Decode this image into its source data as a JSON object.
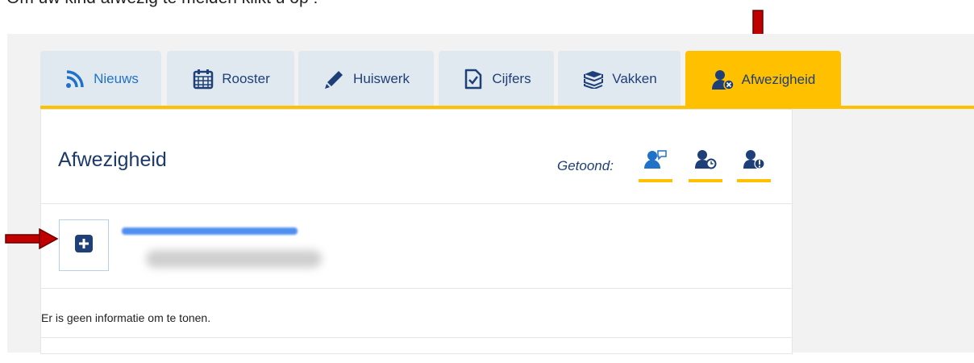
{
  "caption": "Om uw kind afwezig te melden klikt u op :",
  "tabs": [
    {
      "label": "Nieuws",
      "icon": "rss-icon"
    },
    {
      "label": "Rooster",
      "icon": "calendar-icon"
    },
    {
      "label": "Huiswerk",
      "icon": "pencil-icon"
    },
    {
      "label": "Cijfers",
      "icon": "checked-document-icon"
    },
    {
      "label": "Vakken",
      "icon": "books-icon"
    },
    {
      "label": "Afwezigheid",
      "icon": "user-absent-icon",
      "active": true
    }
  ],
  "page": {
    "title": "Afwezigheid",
    "shown_label": "Getoond:",
    "filters": [
      "user-message-icon",
      "user-clock-icon",
      "user-info-icon"
    ]
  },
  "empty_message": "Er is geen informatie om te tonen.",
  "colors": {
    "accent": "#ffc000",
    "primary": "#1f3f78",
    "tab_bg": "#e1e9f0",
    "arrow": "#c00000"
  }
}
